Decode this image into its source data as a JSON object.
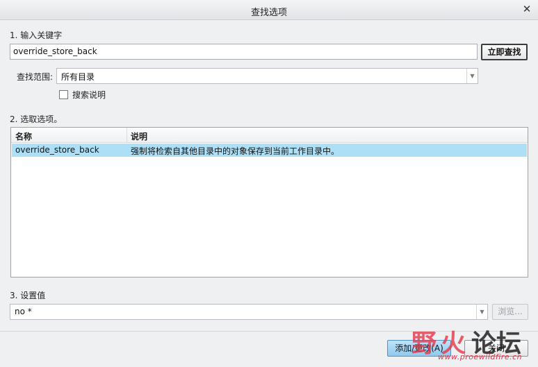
{
  "window": {
    "title": "查找选项"
  },
  "step1": {
    "label": "1. 输入关键字",
    "keyword_value": "override_store_back",
    "find_button": "立即查找",
    "scope_label": "查找范围:",
    "scope_value": "所有目录",
    "search_desc_label": "搜索说明",
    "search_desc_checked": false
  },
  "step2": {
    "label": "2. 选取选项。",
    "columns": [
      "名称",
      "说明"
    ],
    "rows": [
      {
        "name": "override_store_back",
        "description": "强制将检索自其他目录中的对象保存到当前工作目录中。",
        "selected": true
      }
    ]
  },
  "step3": {
    "label": "3. 设置值",
    "value": "no *",
    "browse_button": "浏览..."
  },
  "footer": {
    "add_change_button": "添加/更改(A)",
    "close_button": "关闭"
  },
  "watermark": {
    "char1": "野",
    "char2": "火",
    "char3": "论坛",
    "site": "www.proewildfire.cn"
  },
  "colors": {
    "selection": "#ade0f7",
    "primary_button": "#91c9ef",
    "watermark_red": "#e3394a"
  }
}
